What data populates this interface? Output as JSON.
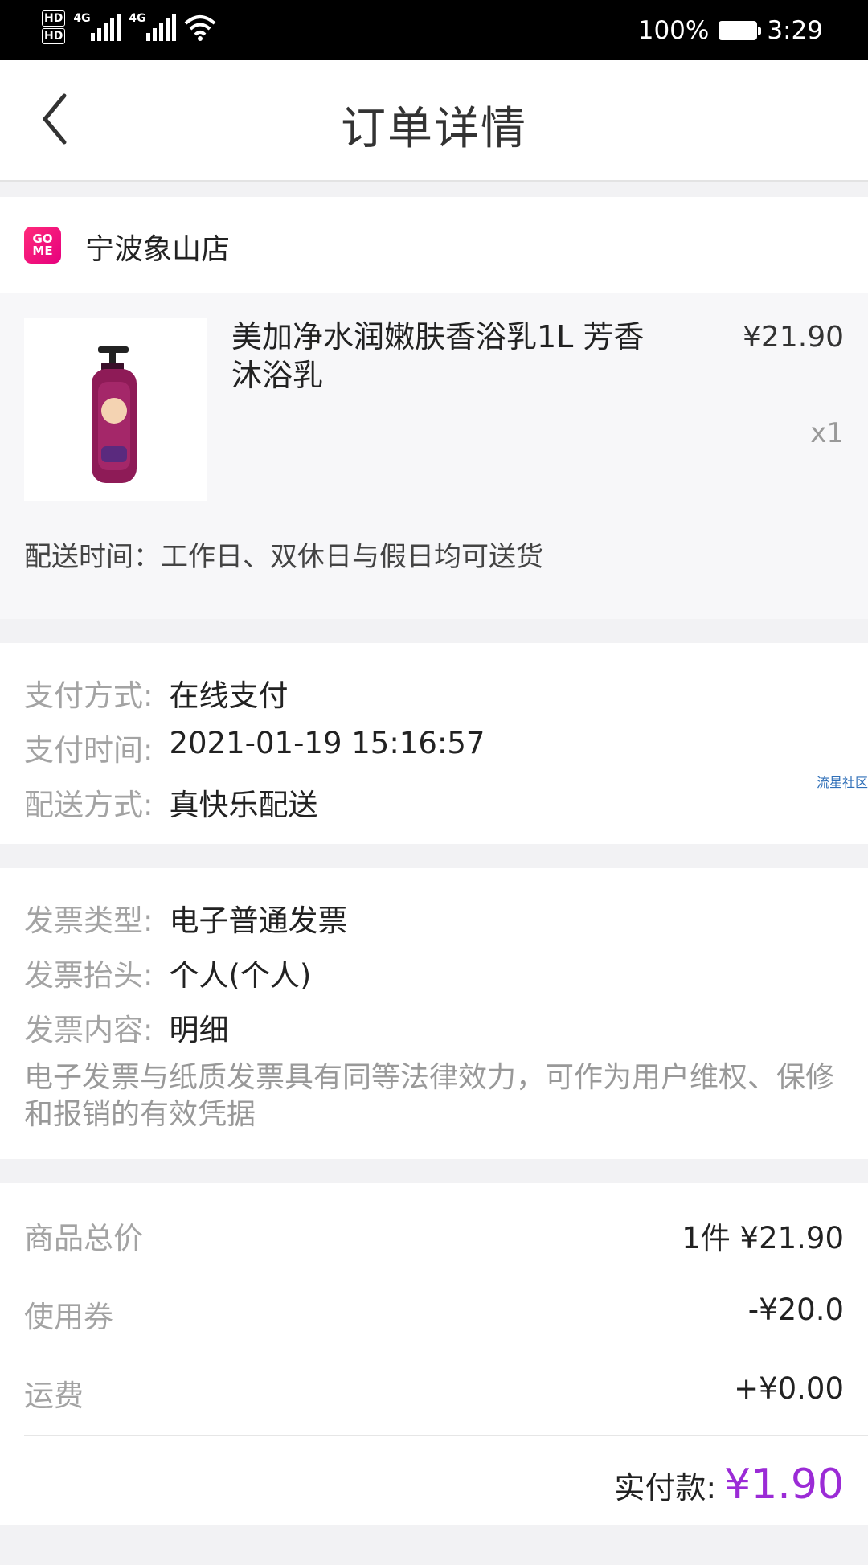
{
  "status_bar": {
    "network_1": "4G",
    "network_2": "4G",
    "hd_1": "HD",
    "hd_2": "HD",
    "battery": "100%",
    "time": "3:29"
  },
  "nav": {
    "title": "订单详情"
  },
  "store": {
    "name": "宁波象山店",
    "logo_text_top": "GO",
    "logo_text_bottom": "ME"
  },
  "product": {
    "title": "美加净水润嫩肤香浴乳1L 芳香沐浴乳",
    "price": "¥21.90",
    "quantity": "x1",
    "delivery_time": "配送时间：工作日、双休日与假日均可送货"
  },
  "payment": {
    "rows": [
      {
        "label": "支付方式:",
        "value": "在线支付"
      },
      {
        "label": "支付时间:",
        "value": "2021-01-19 15:16:57"
      },
      {
        "label": "配送方式:",
        "value": "真快乐配送"
      }
    ],
    "watermark": "流星社区"
  },
  "invoice": {
    "rows": [
      {
        "label": "发票类型:",
        "value": "电子普通发票"
      },
      {
        "label": "发票抬头:",
        "value": "个人(个人)"
      },
      {
        "label": "发票内容:",
        "value": "明细"
      }
    ],
    "note": "电子发票与纸质发票具有同等法律效力，可作为用户维权、保修和报销的有效凭据"
  },
  "summary": {
    "rows": [
      {
        "label": "商品总价",
        "value": "1件 ¥21.90"
      },
      {
        "label": "使用券",
        "value": "-¥20.0"
      },
      {
        "label": "运费",
        "value": "+¥0.00"
      }
    ],
    "paid_label": "实付款:",
    "paid_value": "¥1.90",
    "accent_color": "#9b2bd6"
  }
}
